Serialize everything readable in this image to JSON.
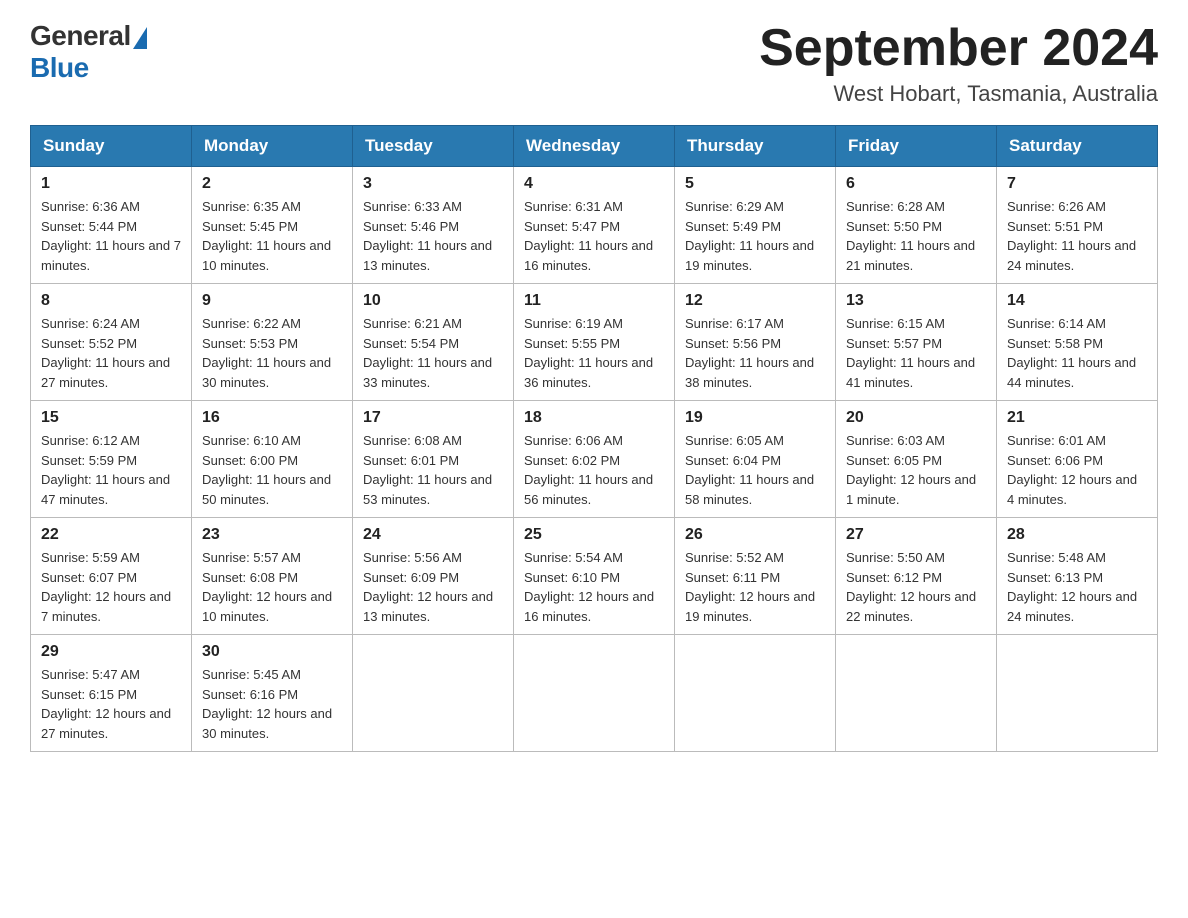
{
  "logo": {
    "general": "General",
    "blue": "Blue"
  },
  "title": {
    "month_year": "September 2024",
    "location": "West Hobart, Tasmania, Australia"
  },
  "days_of_week": [
    "Sunday",
    "Monday",
    "Tuesday",
    "Wednesday",
    "Thursday",
    "Friday",
    "Saturday"
  ],
  "weeks": [
    [
      {
        "day": "1",
        "sunrise": "Sunrise: 6:36 AM",
        "sunset": "Sunset: 5:44 PM",
        "daylight": "Daylight: 11 hours and 7 minutes."
      },
      {
        "day": "2",
        "sunrise": "Sunrise: 6:35 AM",
        "sunset": "Sunset: 5:45 PM",
        "daylight": "Daylight: 11 hours and 10 minutes."
      },
      {
        "day": "3",
        "sunrise": "Sunrise: 6:33 AM",
        "sunset": "Sunset: 5:46 PM",
        "daylight": "Daylight: 11 hours and 13 minutes."
      },
      {
        "day": "4",
        "sunrise": "Sunrise: 6:31 AM",
        "sunset": "Sunset: 5:47 PM",
        "daylight": "Daylight: 11 hours and 16 minutes."
      },
      {
        "day": "5",
        "sunrise": "Sunrise: 6:29 AM",
        "sunset": "Sunset: 5:49 PM",
        "daylight": "Daylight: 11 hours and 19 minutes."
      },
      {
        "day": "6",
        "sunrise": "Sunrise: 6:28 AM",
        "sunset": "Sunset: 5:50 PM",
        "daylight": "Daylight: 11 hours and 21 minutes."
      },
      {
        "day": "7",
        "sunrise": "Sunrise: 6:26 AM",
        "sunset": "Sunset: 5:51 PM",
        "daylight": "Daylight: 11 hours and 24 minutes."
      }
    ],
    [
      {
        "day": "8",
        "sunrise": "Sunrise: 6:24 AM",
        "sunset": "Sunset: 5:52 PM",
        "daylight": "Daylight: 11 hours and 27 minutes."
      },
      {
        "day": "9",
        "sunrise": "Sunrise: 6:22 AM",
        "sunset": "Sunset: 5:53 PM",
        "daylight": "Daylight: 11 hours and 30 minutes."
      },
      {
        "day": "10",
        "sunrise": "Sunrise: 6:21 AM",
        "sunset": "Sunset: 5:54 PM",
        "daylight": "Daylight: 11 hours and 33 minutes."
      },
      {
        "day": "11",
        "sunrise": "Sunrise: 6:19 AM",
        "sunset": "Sunset: 5:55 PM",
        "daylight": "Daylight: 11 hours and 36 minutes."
      },
      {
        "day": "12",
        "sunrise": "Sunrise: 6:17 AM",
        "sunset": "Sunset: 5:56 PM",
        "daylight": "Daylight: 11 hours and 38 minutes."
      },
      {
        "day": "13",
        "sunrise": "Sunrise: 6:15 AM",
        "sunset": "Sunset: 5:57 PM",
        "daylight": "Daylight: 11 hours and 41 minutes."
      },
      {
        "day": "14",
        "sunrise": "Sunrise: 6:14 AM",
        "sunset": "Sunset: 5:58 PM",
        "daylight": "Daylight: 11 hours and 44 minutes."
      }
    ],
    [
      {
        "day": "15",
        "sunrise": "Sunrise: 6:12 AM",
        "sunset": "Sunset: 5:59 PM",
        "daylight": "Daylight: 11 hours and 47 minutes."
      },
      {
        "day": "16",
        "sunrise": "Sunrise: 6:10 AM",
        "sunset": "Sunset: 6:00 PM",
        "daylight": "Daylight: 11 hours and 50 minutes."
      },
      {
        "day": "17",
        "sunrise": "Sunrise: 6:08 AM",
        "sunset": "Sunset: 6:01 PM",
        "daylight": "Daylight: 11 hours and 53 minutes."
      },
      {
        "day": "18",
        "sunrise": "Sunrise: 6:06 AM",
        "sunset": "Sunset: 6:02 PM",
        "daylight": "Daylight: 11 hours and 56 minutes."
      },
      {
        "day": "19",
        "sunrise": "Sunrise: 6:05 AM",
        "sunset": "Sunset: 6:04 PM",
        "daylight": "Daylight: 11 hours and 58 minutes."
      },
      {
        "day": "20",
        "sunrise": "Sunrise: 6:03 AM",
        "sunset": "Sunset: 6:05 PM",
        "daylight": "Daylight: 12 hours and 1 minute."
      },
      {
        "day": "21",
        "sunrise": "Sunrise: 6:01 AM",
        "sunset": "Sunset: 6:06 PM",
        "daylight": "Daylight: 12 hours and 4 minutes."
      }
    ],
    [
      {
        "day": "22",
        "sunrise": "Sunrise: 5:59 AM",
        "sunset": "Sunset: 6:07 PM",
        "daylight": "Daylight: 12 hours and 7 minutes."
      },
      {
        "day": "23",
        "sunrise": "Sunrise: 5:57 AM",
        "sunset": "Sunset: 6:08 PM",
        "daylight": "Daylight: 12 hours and 10 minutes."
      },
      {
        "day": "24",
        "sunrise": "Sunrise: 5:56 AM",
        "sunset": "Sunset: 6:09 PM",
        "daylight": "Daylight: 12 hours and 13 minutes."
      },
      {
        "day": "25",
        "sunrise": "Sunrise: 5:54 AM",
        "sunset": "Sunset: 6:10 PM",
        "daylight": "Daylight: 12 hours and 16 minutes."
      },
      {
        "day": "26",
        "sunrise": "Sunrise: 5:52 AM",
        "sunset": "Sunset: 6:11 PM",
        "daylight": "Daylight: 12 hours and 19 minutes."
      },
      {
        "day": "27",
        "sunrise": "Sunrise: 5:50 AM",
        "sunset": "Sunset: 6:12 PM",
        "daylight": "Daylight: 12 hours and 22 minutes."
      },
      {
        "day": "28",
        "sunrise": "Sunrise: 5:48 AM",
        "sunset": "Sunset: 6:13 PM",
        "daylight": "Daylight: 12 hours and 24 minutes."
      }
    ],
    [
      {
        "day": "29",
        "sunrise": "Sunrise: 5:47 AM",
        "sunset": "Sunset: 6:15 PM",
        "daylight": "Daylight: 12 hours and 27 minutes."
      },
      {
        "day": "30",
        "sunrise": "Sunrise: 5:45 AM",
        "sunset": "Sunset: 6:16 PM",
        "daylight": "Daylight: 12 hours and 30 minutes."
      },
      null,
      null,
      null,
      null,
      null
    ]
  ]
}
